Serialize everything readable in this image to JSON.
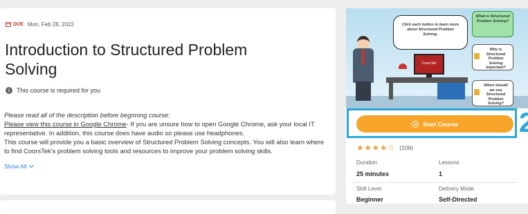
{
  "course": {
    "due_label": "DUE",
    "due_date": "Mon, Feb 28, 2022",
    "title": "Introduction to Structured Problem Solving",
    "required_text": "This course is required for you",
    "description": {
      "line1_italic_part1": "Please read all of the description before beg",
      "line1_italic_part2": "nning course:",
      "link_text": "Please view this course in Google Chrome",
      "after_link": "- If you are unsure how to open Google Chrome, ask your local IT representative. In addition, this course does have audio so please use headphones.",
      "paragraph2": "This course will provide you a basic overview of Structured Problem Solving concepts. You will also learn where to find CoorsTek's problem solving tools and resources to improve your problem solving skills."
    },
    "show_all": "Show All"
  },
  "hero": {
    "bubble_text": "Click each button to learn more about Structured Problem Solving.",
    "buttons": [
      "What is Structured Problem Solving?",
      "Why is Structured Problem Solving important?",
      "When should we use Structured Problem Solving?"
    ],
    "monitor_text": "CoorsTek"
  },
  "sidebar": {
    "start_button": "Start Course",
    "step_number": "2",
    "rating_count": "(106)",
    "stars": "★★★★☆",
    "duration_label": "Duration",
    "duration_value": "25 minutes",
    "lessons_label": "Lessons",
    "lessons_value": "1",
    "skill_label": "Skill Level",
    "skill_value": "Beginner",
    "delivery_label": "Delivery Mode",
    "delivery_value": "Self-Directed"
  },
  "colors": {
    "accent_orange": "#f7a52b",
    "highlight_blue": "#2aa7d8",
    "due_red": "#c0392b",
    "link_blue": "#2a7fd4"
  }
}
